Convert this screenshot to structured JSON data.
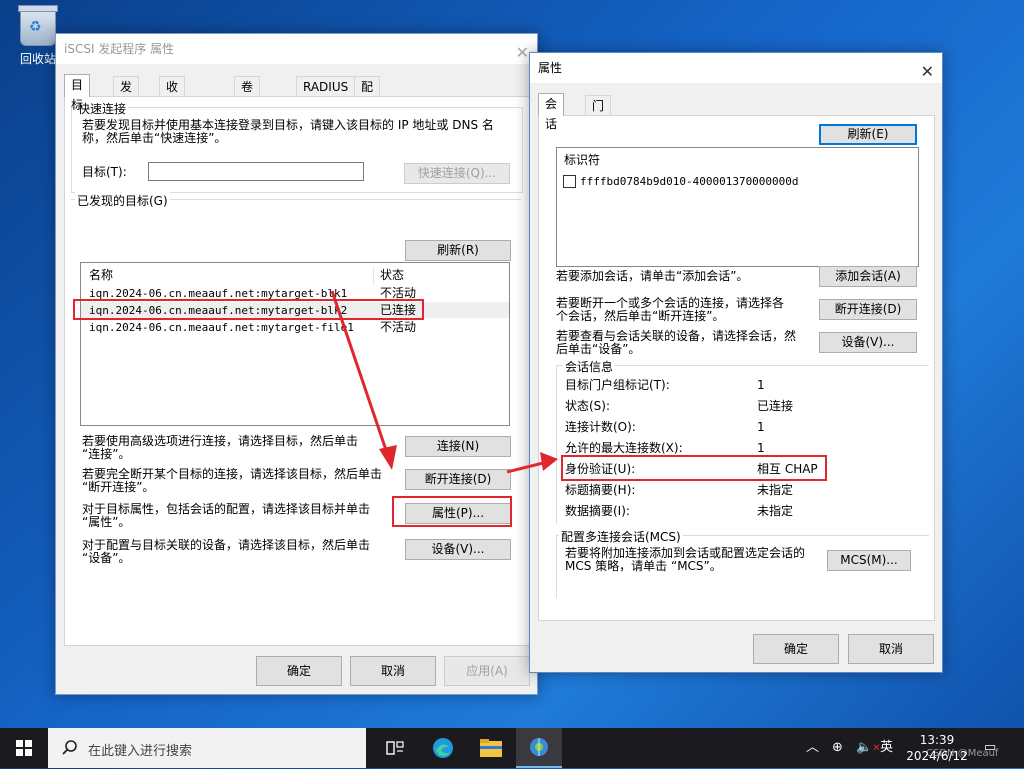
{
  "desktop": {
    "recycle_bin_label": "回收站"
  },
  "main_window": {
    "title": "iSCSI 发起程序 属性",
    "tabs": [
      "目标",
      "发现",
      "收藏的目标",
      "卷和设备",
      "RADIUS",
      "配置"
    ],
    "quick_connect": {
      "group_title": "快速连接",
      "desc_line1": "若要发现目标并使用基本连接登录到目标，请键入该目标的 IP 地址或 DNS 名",
      "desc_line2": "称，然后单击“快速连接”。",
      "target_label": "目标(T):",
      "target_value": "",
      "button": "快速连接(Q)..."
    },
    "discovered": {
      "group_title": "已发现的目标(G)",
      "refresh": "刷新(R)",
      "col_name": "名称",
      "col_status": "状态",
      "rows": [
        {
          "name": "iqn.2024-06.cn.meaauf.net:mytarget-blk1",
          "status": "不活动"
        },
        {
          "name": "iqn.2024-06.cn.meaauf.net:mytarget-blk2",
          "status": "已连接"
        },
        {
          "name": "iqn.2024-06.cn.meaauf.net:mytarget-file1",
          "status": "不活动"
        }
      ]
    },
    "actions": {
      "connect_text1": "若要使用高级选项进行连接，请选择目标，然后单击",
      "connect_text2": "“连接”。",
      "connect_btn": "连接(N)",
      "disconnect_text1": "若要完全断开某个目标的连接，请选择该目标，然后单击",
      "disconnect_text2": "“断开连接”。",
      "disconnect_btn": "断开连接(D)",
      "props_text1": "对于目标属性，包括会话的配置，请选择该目标并单击",
      "props_text2": "“属性”。",
      "props_btn": "属性(P)...",
      "devices_text1": "对于配置与目标关联的设备，请选择该目标，然后单击",
      "devices_text2": "“设备”。",
      "devices_btn": "设备(V)..."
    },
    "footer": {
      "ok": "确定",
      "cancel": "取消",
      "apply": "应用(A)"
    }
  },
  "props_window": {
    "title": "属性",
    "tabs": [
      "会话",
      "门户组"
    ],
    "refresh": "刷新(E)",
    "identifier_header": "标识符",
    "session_id": "ffffbd0784b9d010-400001370000000d",
    "add_text": "若要添加会话，请单击“添加会话”。",
    "add_btn": "添加会话(A)",
    "disc_text1": "若要断开一个或多个会话的连接，请选择各",
    "disc_text2": "个会话，然后单击“断开连接”。",
    "disc_btn": "断开连接(D)",
    "dev_text1": "若要查看与会话关联的设备，请选择会话，然",
    "dev_text2": "后单击“设备”。",
    "dev_btn": "设备(V)...",
    "info_title": "会话信息",
    "info": [
      {
        "k": "目标门户组标记(T):",
        "v": "1"
      },
      {
        "k": "状态(S):",
        "v": "已连接"
      },
      {
        "k": "连接计数(O):",
        "v": "1"
      },
      {
        "k": "允许的最大连接数(X):",
        "v": "1"
      },
      {
        "k": "身份验证(U):",
        "v": "相互 CHAP"
      },
      {
        "k": "标题摘要(H):",
        "v": "未指定"
      },
      {
        "k": "数据摘要(I):",
        "v": "未指定"
      }
    ],
    "mcs_title": "配置多连接会话(MCS)",
    "mcs_text1": "若要将附加连接添加到会话或配置选定会话的",
    "mcs_text2": "MCS 策略，请单击 “MCS”。",
    "mcs_btn": "MCS(M)...",
    "ok": "确定",
    "cancel": "取消"
  },
  "taskbar": {
    "search_placeholder": "在此键入进行搜索",
    "time": "13:39",
    "date": "2024/6/12",
    "ime": "英",
    "watermark": "CSDN @Meauf"
  },
  "colors": {
    "highlight_red": "#e0272e",
    "desktop_blue": "#1565c8",
    "focus_blue": "#0078d7"
  }
}
